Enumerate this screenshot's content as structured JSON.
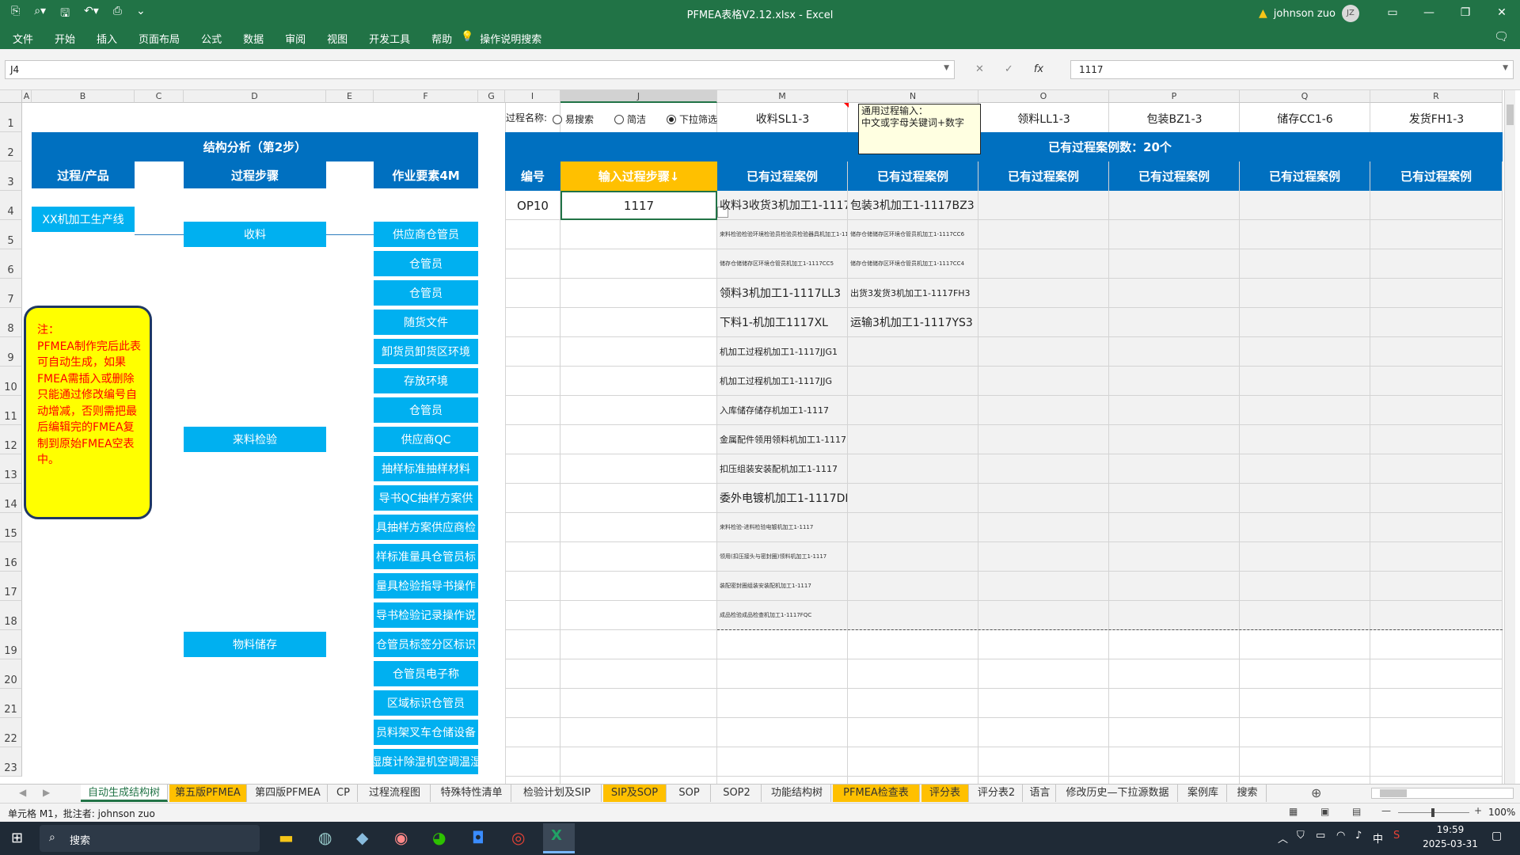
{
  "window": {
    "title": "PFMEA表格V2.12.xlsx  -  Excel",
    "user": "johnson zuo",
    "avatar": "JZ"
  },
  "ribbon": {
    "tabs": [
      "文件",
      "开始",
      "插入",
      "页面布局",
      "公式",
      "数据",
      "审阅",
      "视图",
      "开发工具",
      "帮助"
    ],
    "search_label": "操作说明搜索"
  },
  "formula_bar": {
    "name_box": "J4",
    "value": "1117"
  },
  "columns": [
    "A",
    "B",
    "C",
    "D",
    "E",
    "F",
    "G",
    "I",
    "J",
    "M",
    "N",
    "O",
    "P",
    "Q",
    "R"
  ],
  "rows": [
    "1",
    "2",
    "3",
    "4",
    "5",
    "6",
    "7",
    "8",
    "9",
    "10",
    "11",
    "12",
    "13",
    "14",
    "15",
    "16",
    "17",
    "18",
    "19",
    "20",
    "21",
    "22",
    "23"
  ],
  "structure": {
    "title": "结构分析（第2步）",
    "col_product": "过程/产品",
    "col_step": "过程步骤",
    "col_4m": "作业要素4M",
    "product": "XX机加工生产线",
    "steps": [
      "收料",
      "来料检验",
      "物料储存"
    ],
    "elements": [
      "供应商仓管员",
      "仓管员",
      "仓管员",
      "随货文件",
      "卸货员卸货区环境",
      "存放环境",
      "仓管员",
      "供应商QC",
      "抽样标准抽样材料",
      "导书QC抽样方案供",
      "具抽样方案供应商检",
      "样标准量具仓管员标",
      "量具检验指导书操作",
      "导书检验记录操作说",
      "仓管员标签分区标识",
      "仓管员电子称",
      "区域标识仓管员",
      "员料架叉车仓储设备",
      "湿度计除湿机空调温湿"
    ]
  },
  "note": {
    "text": "注：\nPFMEA制作完后此表可自动生成，如果FMEA需插入或删除只能通过修改编号自动增减，否则需把最后编辑完的FMEA复制到原始FMEA空表中。"
  },
  "process": {
    "name_label": "过程名称:",
    "options": [
      "易搜索",
      "简洁",
      "下拉筛选"
    ],
    "selected_option": "下拉筛选",
    "top_cases": [
      "收料SL1-3",
      "",
      "领料LL1-3",
      "包装BZ1-3",
      "储存CC1-6",
      "发货FH1-3"
    ],
    "count_label": "已有过程案例数：20个",
    "col_no": "编号",
    "col_input": "输入过程步骤↓",
    "col_case": "已有过程案例",
    "op_no": "OP10",
    "input_value": "1117",
    "tooltip_title": "通用过程输入：",
    "tooltip_body": "中文或字母关键词+数字",
    "cases_m": [
      "收料3收货3机加工1-1117SL3",
      "来料检验检验环境检验员检验员检验器具机加工1-1117QC5",
      "储存仓储储存区环境仓管员机加工1-1117CC5",
      "领料3机加工1-1117LL3",
      "下料1-机加工1117XL",
      "机加工过程机加工1-1117JJG1",
      "机加工过程机加工1-1117JJG",
      "入库储存储存机加工1-1117",
      "金属配件领用领料机加工1-1117",
      "扣压组装安装配机加工1-1117",
      "委外电镀机加工1-1117DD",
      "来料检验-进料检验电镀机加工1-1117",
      "领用(扣压接头与密封圈)领料机加工1-1117",
      "装配密封圈组装安装配机加工1-1117",
      "成品检验成品检查机加工1-1117FQC"
    ],
    "cases_n": [
      "包装3机加工1-1117BZ3",
      "储存仓储储存区环境仓管员机加工1-1117CC6",
      "储存仓储储存区环境仓管员机加工1-1117CC4",
      "出货3发货3机加工1-1117FH3",
      "运输3机加工1-1117YS3"
    ]
  },
  "sheet_tabs": [
    {
      "label": "自动生成结构树",
      "style": "active"
    },
    {
      "label": "第五版PFMEA",
      "style": "orange"
    },
    {
      "label": "第四版PFMEA",
      "style": ""
    },
    {
      "label": "CP",
      "style": ""
    },
    {
      "label": "过程流程图",
      "style": ""
    },
    {
      "label": "特殊特性清单",
      "style": ""
    },
    {
      "label": "检验计划及SIP",
      "style": ""
    },
    {
      "label": "SIP及SOP",
      "style": "orange"
    },
    {
      "label": "SOP",
      "style": ""
    },
    {
      "label": "SOP2",
      "style": ""
    },
    {
      "label": "功能结构树",
      "style": ""
    },
    {
      "label": "PFMEA检查表",
      "style": "orange"
    },
    {
      "label": "评分表",
      "style": "orange"
    },
    {
      "label": "评分表2",
      "style": ""
    },
    {
      "label": "语言",
      "style": ""
    },
    {
      "label": "修改历史—下拉源数据",
      "style": ""
    },
    {
      "label": "案例库",
      "style": ""
    },
    {
      "label": "搜索",
      "style": ""
    }
  ],
  "status": {
    "left": "单元格 M1，批注者: johnson zuo",
    "zoom": "100%"
  },
  "taskbar": {
    "search": "搜索",
    "time": "19:59",
    "date": "2025-03-31",
    "ime": "中"
  },
  "colors": {
    "excel_green": "#217346",
    "header_blue": "#0070c0",
    "cyan": "#00b0f0",
    "gold": "#ffc000",
    "note_yellow": "#ffff00",
    "note_red": "#ff0000"
  }
}
